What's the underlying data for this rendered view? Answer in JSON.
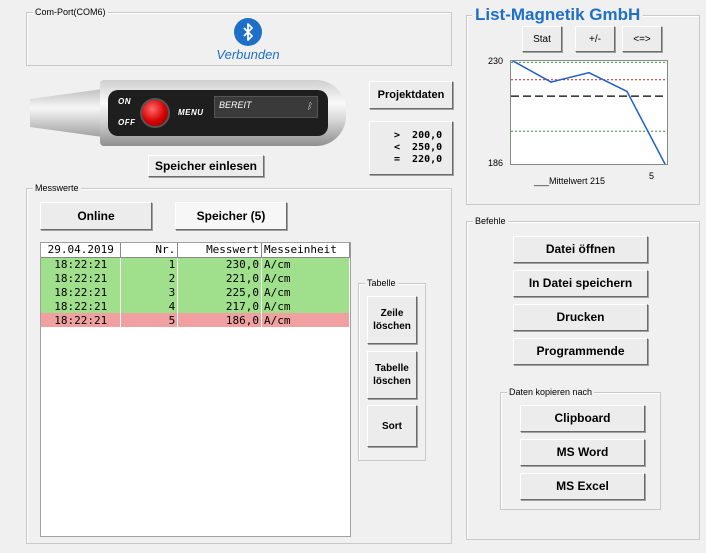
{
  "com_port": {
    "title": "Com-Port(COM6)",
    "bluetooth_icon": "bluetooth-icon",
    "status": "Verbunden"
  },
  "device": {
    "on": "ON",
    "off": "OFF",
    "menu": "MENU",
    "display": "BEREIT",
    "display_icon": "bluetooth-icon"
  },
  "buttons": {
    "projektdaten": "Projektdaten",
    "speicher_einlesen": "Speicher einlesen",
    "limits": {
      "gt": ">  200,0",
      "lt": "<  250,0",
      "eq": "=  220,0"
    }
  },
  "brand": "List-Magnetik GmbH",
  "chart_controls": {
    "stat": "Stat",
    "plusminus": "+/-",
    "arrows": "<=>"
  },
  "chart_data": {
    "type": "line",
    "x": [
      1,
      2,
      3,
      4,
      5
    ],
    "values": [
      230.0,
      221.0,
      225.0,
      217.0,
      186.0
    ],
    "ylim": [
      186,
      230
    ],
    "ytick_labels": [
      "230",
      "186"
    ],
    "xtick_labels": [
      "5"
    ],
    "mean": 215,
    "reference_lines": {
      "upper_green": 230,
      "lower_green": 200,
      "red": 222
    },
    "legend_text": "___Mittelwert 215",
    "colors": {
      "line": "#1f5fc8",
      "green": "#2e9e2e",
      "red": "#cc2222",
      "mean": "#000000"
    }
  },
  "messwerte": {
    "title": "Messwerte",
    "tab_online": "Online",
    "tab_speicher": "Speicher (5)",
    "headers": [
      "29.04.2019",
      "Nr.",
      "Messwert",
      "Messeinheit"
    ],
    "rows": [
      {
        "time": "18:22:21",
        "nr": "1",
        "value": "230,0",
        "unit": "A/cm",
        "status": "ok"
      },
      {
        "time": "18:22:21",
        "nr": "2",
        "value": "221,0",
        "unit": "A/cm",
        "status": "ok"
      },
      {
        "time": "18:22:21",
        "nr": "3",
        "value": "225,0",
        "unit": "A/cm",
        "status": "ok"
      },
      {
        "time": "18:22:21",
        "nr": "4",
        "value": "217,0",
        "unit": "A/cm",
        "status": "ok"
      },
      {
        "time": "18:22:21",
        "nr": "5",
        "value": "186,0",
        "unit": "A/cm",
        "status": "bad"
      }
    ],
    "row_colors": {
      "ok": "#a0e08c",
      "bad": "#f0a0a0"
    }
  },
  "tabelle": {
    "title": "Tabelle",
    "zeile_l1": "Zeile",
    "zeile_l2": "löschen",
    "tabelle_l1": "Tabelle",
    "tabelle_l2": "löschen",
    "sort": "Sort"
  },
  "befehle": {
    "title": "Befehle",
    "datei_oeffnen": "Datei öffnen",
    "in_datei_speichern": "In Datei speichern",
    "drucken": "Drucken",
    "programmende": "Programmende"
  },
  "daten_kopieren": {
    "title": "Daten kopieren nach",
    "clipboard": "Clipboard",
    "ms_word": "MS Word",
    "ms_excel": "MS Excel"
  },
  "accent_color": "#1e6fc8"
}
